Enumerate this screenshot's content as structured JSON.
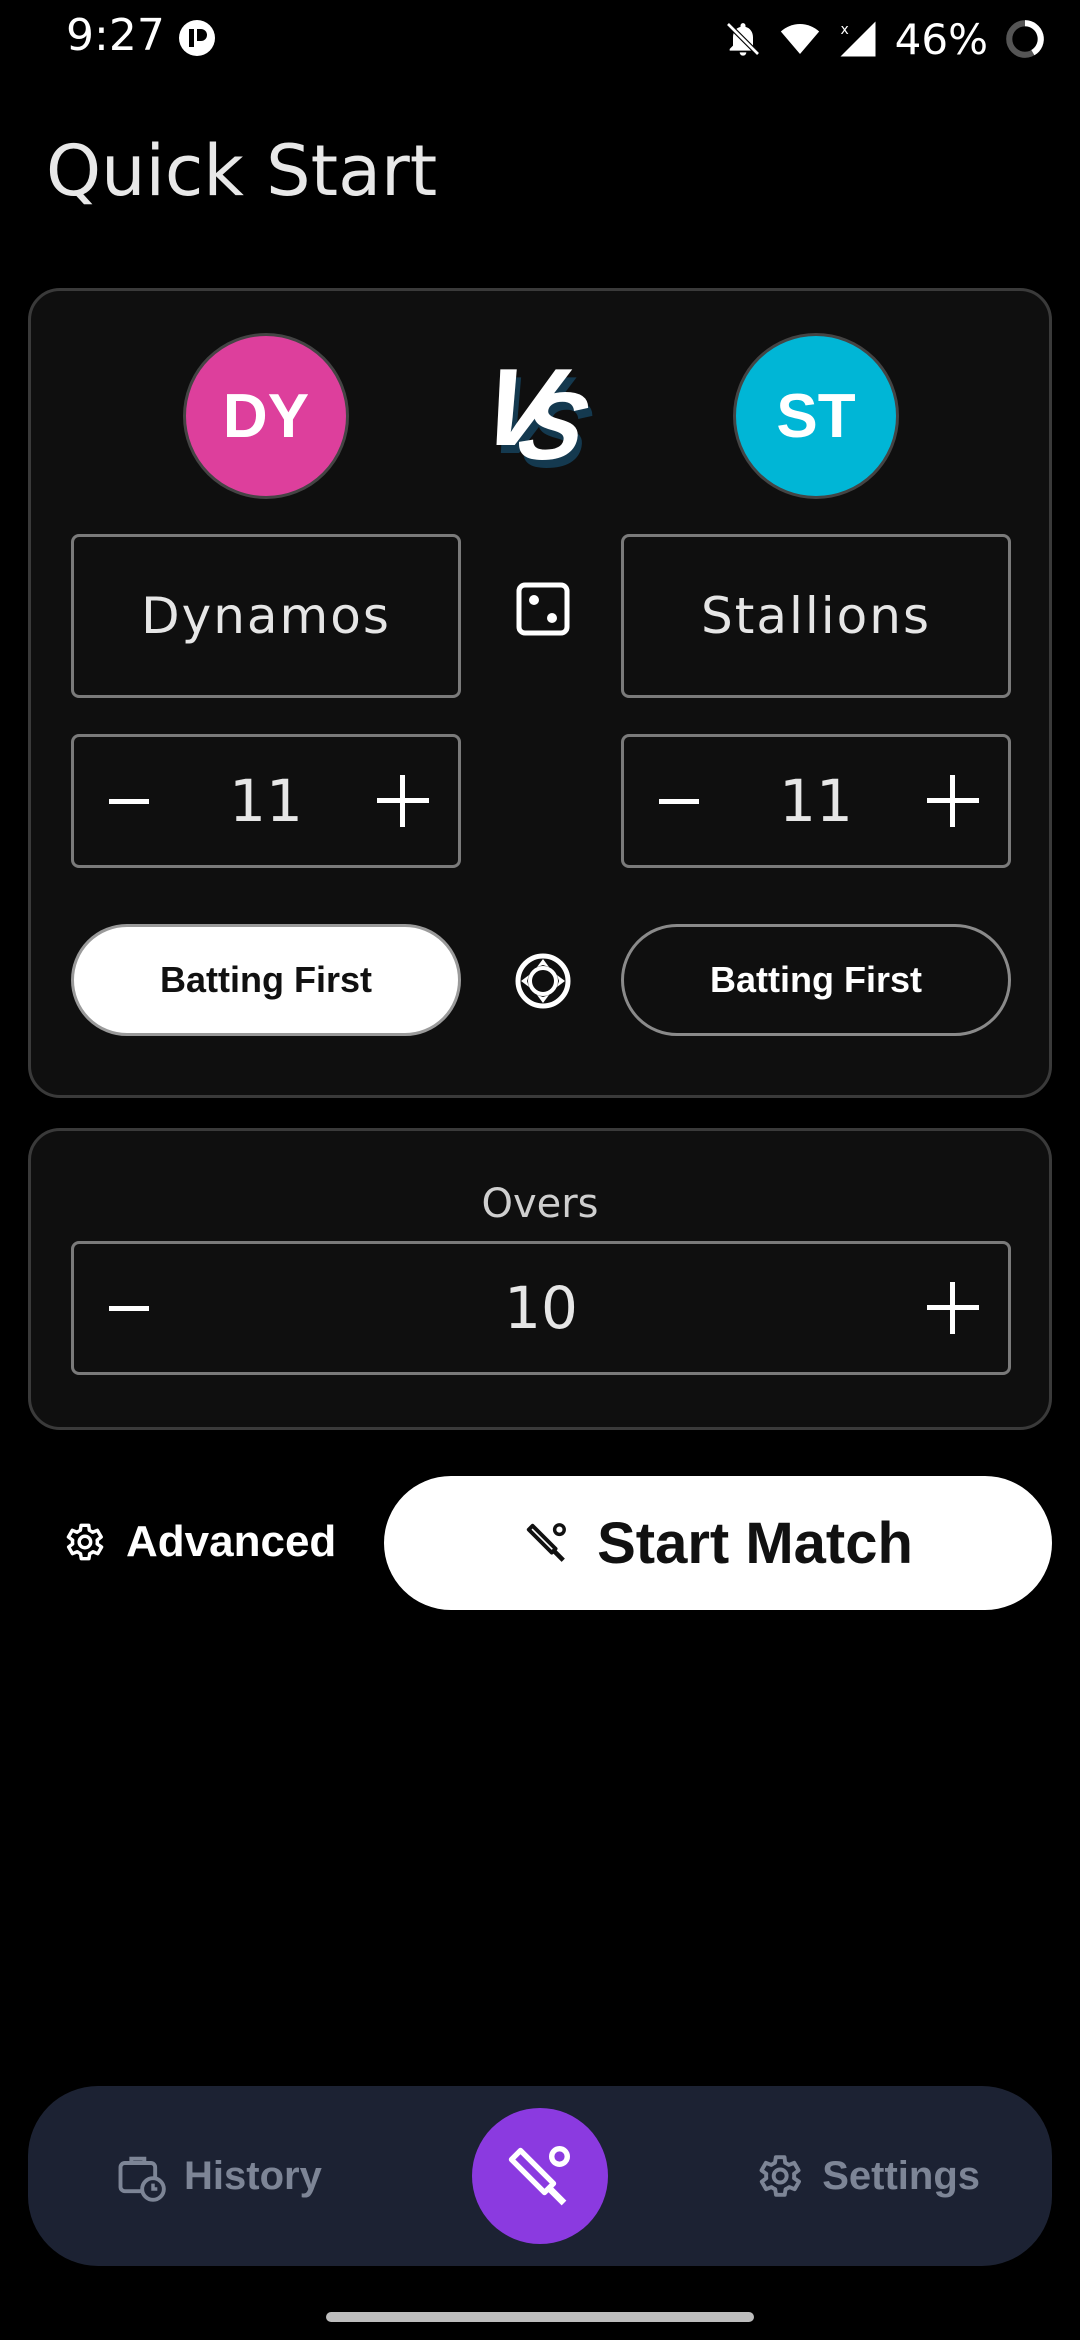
{
  "status": {
    "time": "9:27",
    "battery": "46%"
  },
  "page": {
    "title": "Quick Start"
  },
  "team_a": {
    "initials": "DY",
    "name": "Dynamos",
    "players": "11",
    "batting_label": "Batting First",
    "batting_selected": true,
    "color": "#dd3f9c"
  },
  "team_b": {
    "initials": "ST",
    "name": "Stallions",
    "players": "11",
    "batting_label": "Batting First",
    "batting_selected": false,
    "color": "#00b6d6"
  },
  "overs": {
    "label": "Overs",
    "value": "10"
  },
  "actions": {
    "advanced_label": "Advanced",
    "start_label": "Start Match"
  },
  "nav": {
    "history_label": "History",
    "settings_label": "Settings",
    "active": "match",
    "fab_color": "#8b3ae0"
  },
  "icons": [
    "app-indicator-icon",
    "notifications-off-icon",
    "wifi-icon",
    "signal-icon",
    "battery-ring-icon",
    "vs-logo",
    "dice-icon",
    "minus-icon",
    "plus-icon",
    "toss-coin-icon",
    "gear-icon",
    "cricket-bat-icon",
    "history-icon"
  ]
}
